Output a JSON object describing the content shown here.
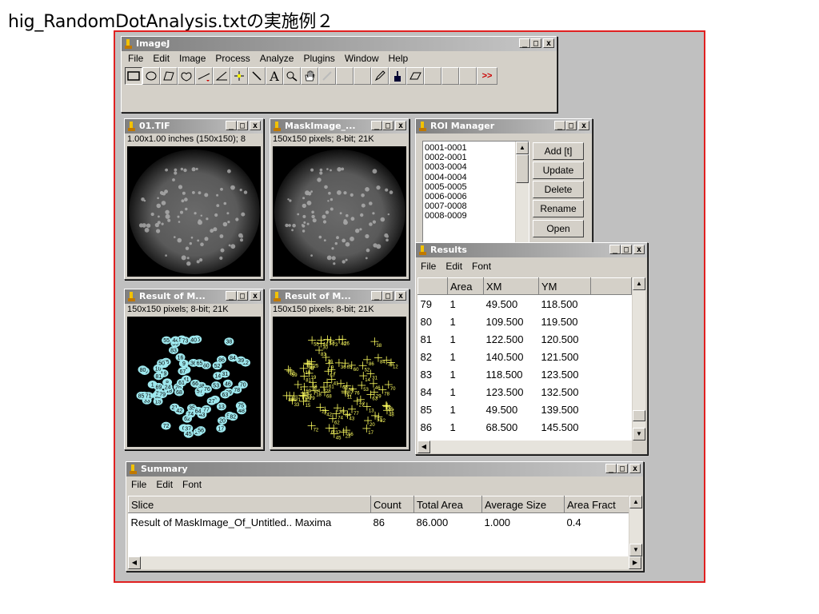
{
  "slide_title": "hig_RandomDotAnalysis.txtの実施例２",
  "imagej": {
    "title": "ImageJ",
    "menu": [
      "File",
      "Edit",
      "Image",
      "Process",
      "Analyze",
      "Plugins",
      "Window",
      "Help"
    ],
    "tools": [
      "rectangle-tool-icon",
      "oval-tool-icon",
      "polygon-tool-icon",
      "freehand-tool-icon",
      "line-tool-icon",
      "angle-tool-icon",
      "point-tool-icon",
      "wand-tool-icon",
      "text-tool-icon",
      "magnifier-tool-icon",
      "hand-tool-icon",
      "dropper-tool-icon",
      "",
      "",
      "pencil-tool-icon",
      "brush-tool-icon",
      "eraser-tool-icon",
      "",
      "",
      ">>"
    ],
    "more_label": ">>",
    "text_tool_label": "A"
  },
  "window_controls": {
    "minimize": "_",
    "maximize": "□",
    "close": "x"
  },
  "img1": {
    "title": "01.TIF",
    "info": "1.00x1.00 inches (150x150); 8"
  },
  "img2": {
    "title": "MaskImage_...",
    "info": "150x150 pixels; 8-bit; 21K"
  },
  "img3": {
    "title": "Result of M...",
    "info": "150x150 pixels; 8-bit; 21K"
  },
  "img4": {
    "title": "Result of M...",
    "info": "150x150 pixels; 8-bit; 21K"
  },
  "roi": {
    "title": "ROI Manager",
    "items": [
      "0001-0001",
      "0002-0001",
      "0003-0004",
      "0004-0004",
      "0005-0005",
      "0006-0006",
      "0007-0008",
      "0008-0009"
    ],
    "buttons": [
      "Add [t]",
      "Update",
      "Delete",
      "Rename",
      "Open"
    ]
  },
  "results": {
    "title": "Results",
    "menu": [
      "File",
      "Edit",
      "Font"
    ],
    "headers": [
      "",
      "Area",
      "XM",
      "YM"
    ],
    "rows": [
      [
        "79",
        "1",
        "49.500",
        "118.500"
      ],
      [
        "80",
        "1",
        "109.500",
        "119.500"
      ],
      [
        "81",
        "1",
        "122.500",
        "120.500"
      ],
      [
        "82",
        "1",
        "140.500",
        "121.500"
      ],
      [
        "83",
        "1",
        "118.500",
        "123.500"
      ],
      [
        "84",
        "1",
        "123.500",
        "132.500"
      ],
      [
        "85",
        "1",
        "49.500",
        "139.500"
      ],
      [
        "86",
        "1",
        "68.500",
        "145.500"
      ]
    ]
  },
  "summary": {
    "title": "Summary",
    "menu": [
      "File",
      "Edit",
      "Font"
    ],
    "headers": [
      "Slice",
      "Count",
      "Total Area",
      "Average Size",
      "Area Fract"
    ],
    "rows": [
      [
        "Result of MaskImage_Of_Untitled.. Maxima",
        "86",
        "86.000",
        "1.000",
        "0.4"
      ]
    ]
  },
  "colors": {
    "accent_border": "#e02020",
    "roi_label": "#9ee8ee",
    "point_marker": "#ffff60"
  },
  "scroll_arrows": {
    "up": "▲",
    "down": "▼",
    "left": "◀",
    "right": "▶"
  }
}
